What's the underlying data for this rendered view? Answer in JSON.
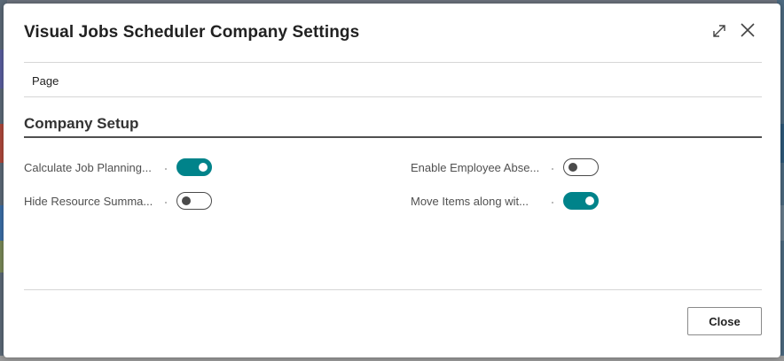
{
  "dialog": {
    "title": "Visual Jobs Scheduler Company Settings",
    "expand_icon": "expand-diagonal-icon",
    "close_icon": "close-icon"
  },
  "action_bar": {
    "page_label": "Page"
  },
  "section": {
    "title": "Company Setup"
  },
  "fields": [
    {
      "label": "Calculate Job Planning...",
      "value": true
    },
    {
      "label": "Hide Resource Summa...",
      "value": false
    },
    {
      "label": "Enable Employee Abse...",
      "value": false
    },
    {
      "label": "Move Items along wit...",
      "value": true
    }
  ],
  "footer": {
    "close_label": "Close"
  },
  "colors": {
    "toggle_on": "#00838a",
    "toggle_off_border": "#4a4a4a",
    "text_primary": "#212121"
  }
}
